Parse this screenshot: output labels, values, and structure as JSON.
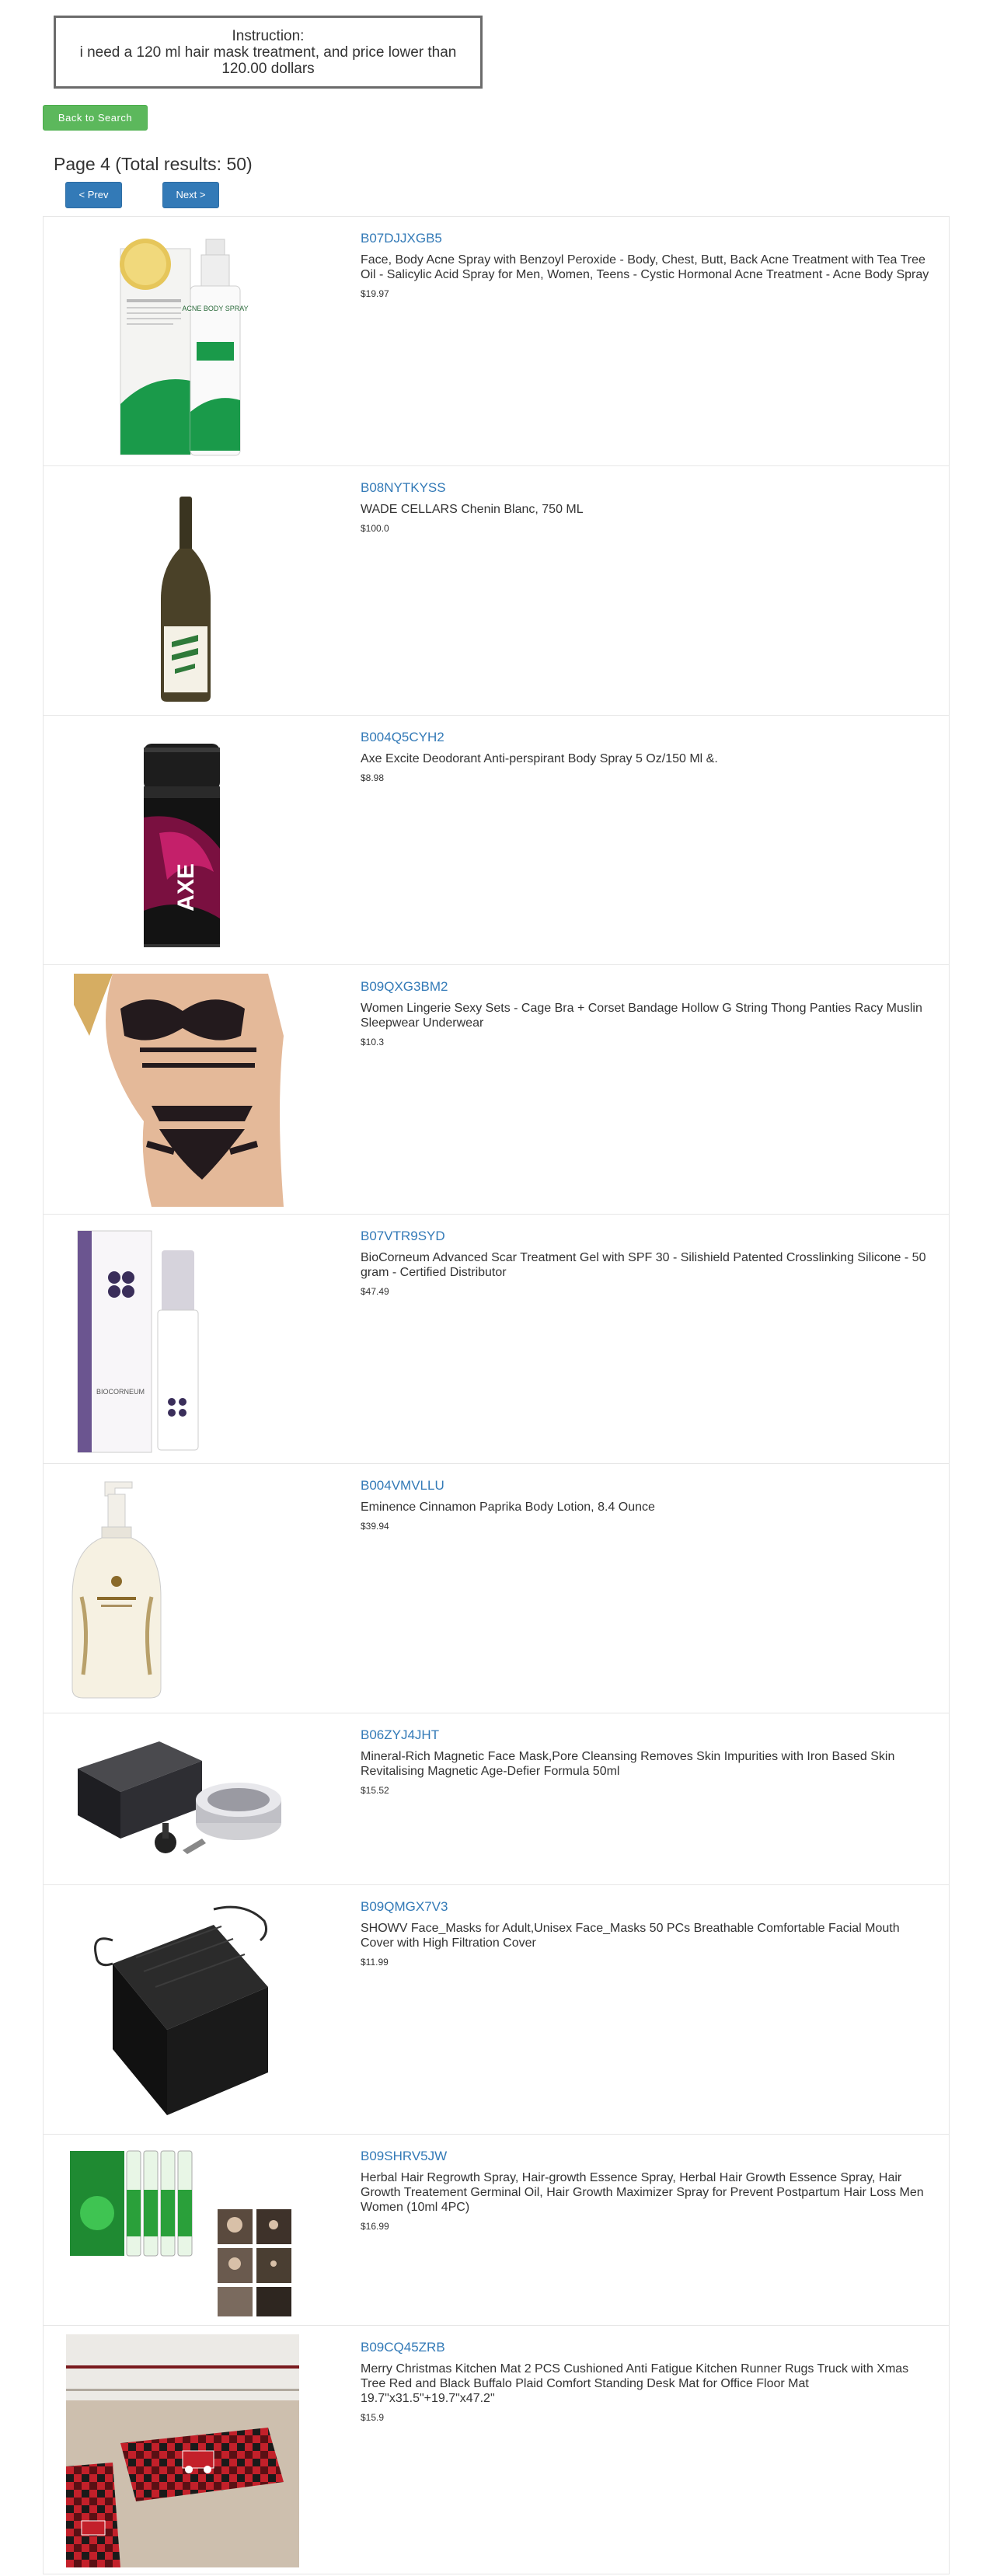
{
  "instruction": {
    "label": "Instruction:",
    "text": "i need a 120 ml hair mask treatment, and price lower than 120.00 dollars"
  },
  "back_button": "Back to Search",
  "page_info": "Page 4 (Total results: 50)",
  "pagination": {
    "prev": "< Prev",
    "next": "Next >"
  },
  "products": [
    {
      "asin": "B07DJJXGB5",
      "title": "Face, Body Acne Spray with Benzoyl Peroxide - Body, Chest, Butt, Back Acne Treatment with Tea Tree Oil - Salicylic Acid Spray for Men, Women, Teens - Cystic Hormonal Acne Treatment - Acne Body Spray",
      "price": "$19.97",
      "image": "acne-body-spray-image",
      "image_text": "ACNE BODY SPRAY"
    },
    {
      "asin": "B08NYTKYSS",
      "title": "WADE CELLARS Chenin Blanc, 750 ML",
      "price": "$100.0",
      "image": "wine-bottle-image"
    },
    {
      "asin": "B004Q5CYH2",
      "title": "Axe Excite Deodorant Anti-perspirant Body Spray 5 Oz/150 Ml &.",
      "price": "$8.98",
      "image": "deodorant-can-image",
      "image_text": "AXE"
    },
    {
      "asin": "B09QXG3BM2",
      "title": "Women Lingerie Sexy Sets - Cage Bra + Corset Bandage Hollow G String Thong Panties Racy Muslin Sleepwear Underwear",
      "price": "$10.3",
      "image": "lingerie-image"
    },
    {
      "asin": "B07VTR9SYD",
      "title": "BioCorneum Advanced Scar Treatment Gel with SPF 30 - Silishield Patented Crosslinking Silicone - 50 gram - Certified Distributor",
      "price": "$47.49",
      "image": "scar-gel-image",
      "image_text": "BIOCORNEUM"
    },
    {
      "asin": "B004VMVLLU",
      "title": "Eminence Cinnamon Paprika Body Lotion, 8.4 Ounce",
      "price": "$39.94",
      "image": "lotion-pump-bottle-image"
    },
    {
      "asin": "B06ZYJ4JHT",
      "title": "Mineral-Rich Magnetic Face Mask,Pore Cleansing Removes Skin Impurities with Iron Based Skin Revitalising Magnetic Age-Defier Formula 50ml",
      "price": "$15.52",
      "image": "magnetic-mask-jar-image"
    },
    {
      "asin": "B09QMGX7V3",
      "title": "SHOWV Face_Masks for Adult,Unisex Face_Masks 50 PCs Breathable Comfortable Facial Mouth Cover with High Filtration Cover",
      "price": "$11.99",
      "image": "black-face-masks-image"
    },
    {
      "asin": "B09SHRV5JW",
      "title": "Herbal Hair Regrowth Spray, Hair-growth Essence Spray, Herbal Hair Growth Essence Spray, Hair Growth Treatement Germinal Oil, Hair Growth Maximizer Spray for Prevent Postpartum Hair Loss Men Women (10ml 4PC)",
      "price": "$16.99",
      "image": "hair-growth-serum-image"
    },
    {
      "asin": "B09CQ45ZRB",
      "title": "Merry Christmas Kitchen Mat 2 PCS Cushioned Anti Fatigue Kitchen Runner Rugs Truck with Xmas Tree Red and Black Buffalo Plaid Comfort Standing Desk Mat for Office Floor Mat 19.7\"x31.5\"+19.7\"x47.2\"",
      "price": "$15.9",
      "image": "kitchen-mat-image"
    }
  ]
}
